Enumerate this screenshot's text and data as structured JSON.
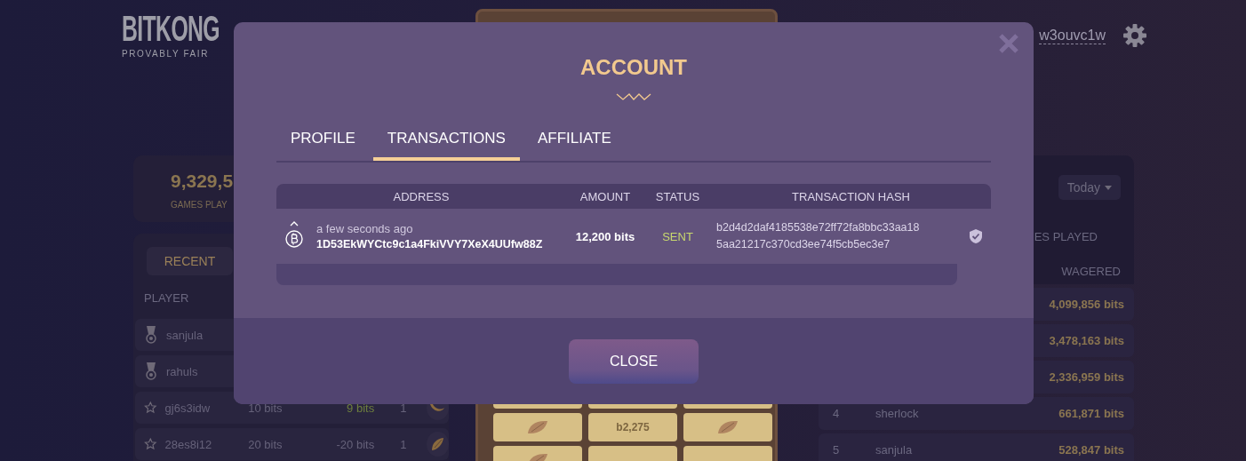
{
  "header": {
    "logo": "BITKONG",
    "tagline": "PROVABLY FAIR",
    "username": "w3ouvc1w"
  },
  "stats": {
    "value": "9,329,5",
    "label": "GAMES PLAY"
  },
  "recent": {
    "tabs": [
      {
        "label": "RECENT",
        "selected": true
      }
    ],
    "columns": [
      "PLAYER"
    ],
    "rows": [
      {
        "kind": "medal",
        "player": "sanjula"
      },
      {
        "kind": "medal",
        "player": "rahuls"
      },
      {
        "kind": "star",
        "player": "gj6s3idw",
        "bet": "10 bits",
        "profit": "9 bits",
        "won": true,
        "count": "1",
        "fruit": {
          "kind": "banana"
        }
      },
      {
        "kind": "star",
        "player": "28es8i12",
        "bet": "20 bits",
        "profit": "-20 bits",
        "won": false,
        "count": "1",
        "fruit": {
          "kind": "slice"
        }
      }
    ]
  },
  "board": {
    "rows": [
      [
        {
          "kind": "blank"
        },
        {
          "kind": "blank"
        },
        {
          "kind": "blank"
        }
      ],
      [
        {
          "kind": "fruit"
        },
        {
          "kind": "value",
          "text": "b2,275"
        },
        {
          "kind": "fruit"
        }
      ],
      [
        {
          "kind": "fruit"
        },
        {
          "kind": "blank"
        },
        {
          "kind": "blank"
        }
      ]
    ]
  },
  "leaderboard": {
    "period": "Today",
    "columns": [
      "ES PLAYED",
      "WAGERED"
    ],
    "rows": [
      {
        "wagered": "4,099,856 bits"
      },
      {
        "wagered": "3,478,163 bits"
      },
      {
        "wagered": "2,336,959 bits"
      },
      {
        "rank": "4",
        "player": "sherlock",
        "wagered": "661,871 bits"
      },
      {
        "rank": "5",
        "player": "sanjula",
        "wagered": "528,847 bits"
      }
    ]
  },
  "modal": {
    "title": "ACCOUNT",
    "tabs": [
      {
        "label": "PROFILE",
        "selected": false
      },
      {
        "label": "TRANSACTIONS",
        "selected": true
      },
      {
        "label": "AFFILIATE",
        "selected": false
      }
    ],
    "table": {
      "columns": [
        "ADDRESS",
        "AMOUNT",
        "STATUS",
        "TRANSACTION HASH"
      ],
      "rows": [
        {
          "time": "a few seconds ago",
          "address": "1D53EkWYCtc9c1a4FkiVVY7XeX4UUfw88Z",
          "amount": "12,200 bits",
          "status": "SENT",
          "hash_lines": [
            "b2d4d2daf4185538e72ff72fa8bbc33aa18",
            "5aa21217c370cd3ee74f5cb5ec3e7"
          ],
          "verified": true
        }
      ]
    },
    "close_button": "CLOSE"
  }
}
